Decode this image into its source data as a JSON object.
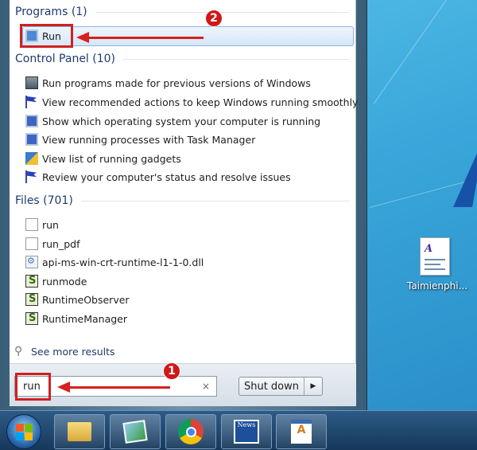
{
  "programs": {
    "header": "Programs (1)",
    "items": [
      {
        "label": "Run",
        "icon": "run-icon"
      }
    ]
  },
  "control_panel": {
    "header": "Control Panel (10)",
    "items": [
      {
        "label": "Run programs made for previous versions of Windows",
        "icon": "compat-icon"
      },
      {
        "label": "View recommended actions to keep Windows running smoothly",
        "icon": "flag-icon"
      },
      {
        "label": "Show which operating system your computer is running",
        "icon": "monitor-icon"
      },
      {
        "label": "View running processes with Task Manager",
        "icon": "monitor-icon"
      },
      {
        "label": "View list of running gadgets",
        "icon": "gadgets-icon"
      },
      {
        "label": "Review your computer's status and resolve issues",
        "icon": "flag-icon"
      }
    ]
  },
  "files": {
    "header": "Files (701)",
    "items": [
      {
        "label": "run",
        "icon": "file-icon"
      },
      {
        "label": "run_pdf",
        "icon": "file-icon"
      },
      {
        "label": "api-ms-win-crt-runtime-l1-1-0.dll",
        "icon": "dll-icon"
      },
      {
        "label": "runmode",
        "icon": "script-icon"
      },
      {
        "label": "RuntimeObserver",
        "icon": "script-icon"
      },
      {
        "label": "RuntimeManager",
        "icon": "script-icon"
      }
    ]
  },
  "see_more": "See more results",
  "search": {
    "value": "run",
    "clear": "×"
  },
  "shutdown": {
    "label": "Shut down",
    "arrow": "▶"
  },
  "annotations": {
    "step1": "1",
    "step2": "2",
    "color": "#d02020"
  },
  "desktop": {
    "icon_label": "Taimienphi..."
  },
  "taskbar": {
    "items": [
      "file-explorer-icon",
      "photo-viewer-icon",
      "chrome-icon",
      "news-icon",
      "document-icon"
    ]
  },
  "news_text": "News"
}
